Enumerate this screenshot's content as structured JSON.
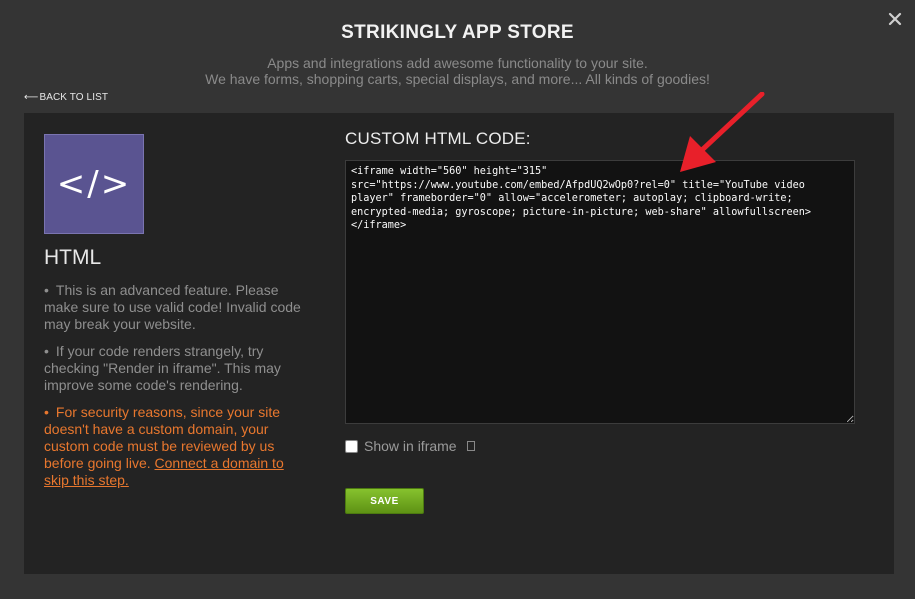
{
  "header": {
    "title": "STRIKINGLY APP STORE",
    "subtitle_line1": "Apps and integrations add awesome functionality to your site.",
    "subtitle_line2": "We have forms, shopping carts, special displays, and more... All kinds of goodies!"
  },
  "nav": {
    "back_arrow": "⟵",
    "back_label": "BACK TO LIST"
  },
  "app": {
    "icon_glyph": "</>",
    "name": "HTML",
    "notes": [
      "This is an advanced feature. Please make sure to use valid code! Invalid code may break your website.",
      "If your code renders strangely, try checking \"Render in iframe\". This may improve some code's rendering."
    ],
    "warning_text": "For security reasons, since your site doesn't have a custom domain, your custom code must be reviewed by us before going live. ",
    "warning_link": "Connect a domain to skip this step.",
    "bullet": "•"
  },
  "editor": {
    "title": "CUSTOM HTML CODE:",
    "code": "<iframe width=\"560\" height=\"315\"\nsrc=\"https://www.youtube.com/embed/AfpdUQ2wOp0?rel=0\" title=\"YouTube video\nplayer\" frameborder=\"0\" allow=\"accelerometer; autoplay; clipboard-write;\nencrypted-media; gyroscope; picture-in-picture; web-share\" allowfullscreen>\n</iframe>",
    "iframe_label": "Show in iframe",
    "save_label": "SAVE"
  },
  "colors": {
    "background": "#343434",
    "panel": "#232323",
    "accent_green": "#6fa81f",
    "warning_orange": "#e8772e",
    "icon_purple": "#5a5491",
    "annotation_red": "#e8202a"
  }
}
